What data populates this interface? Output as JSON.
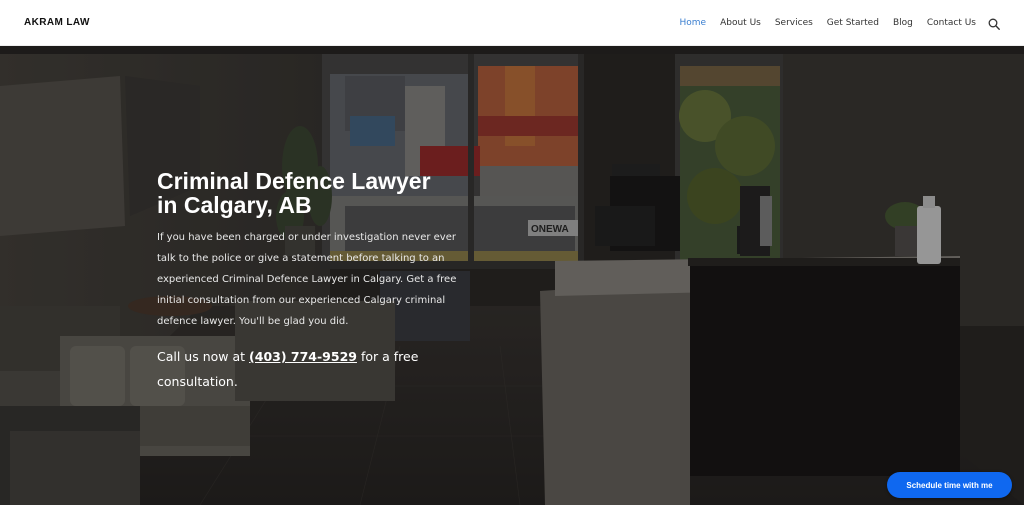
{
  "brand": {
    "logo_text": "AKRAM LAW"
  },
  "nav": {
    "items": [
      {
        "label": "Home",
        "active": true
      },
      {
        "label": "About Us",
        "active": false
      },
      {
        "label": "Services",
        "active": false
      },
      {
        "label": "Get Started",
        "active": false
      },
      {
        "label": "Blog",
        "active": false
      },
      {
        "label": "Contact Us",
        "active": false
      }
    ],
    "search_icon": "search-icon"
  },
  "hero": {
    "title": "Criminal Defence Lawyer in Calgary, AB",
    "body": "If you have been charged or under investigation never ever talk to the police or give a statement before talking to an experienced Criminal Defence Lawyer in Calgary. Get a free initial consultation from our experienced Calgary criminal defence lawyer. You'll be glad you did.",
    "cta_prefix": "Call us now at",
    "cta_phone": "(403) 774-9529",
    "cta_suffix": "for a free consultation.",
    "window_sign": "ONEWA"
  },
  "schedule_button": {
    "label": "Schedule time with me"
  },
  "colors": {
    "nav_active": "#3b7fd0",
    "nav_text": "#333333",
    "button_blue": "#0f68f0",
    "hero_overlay": "#2c2926"
  }
}
